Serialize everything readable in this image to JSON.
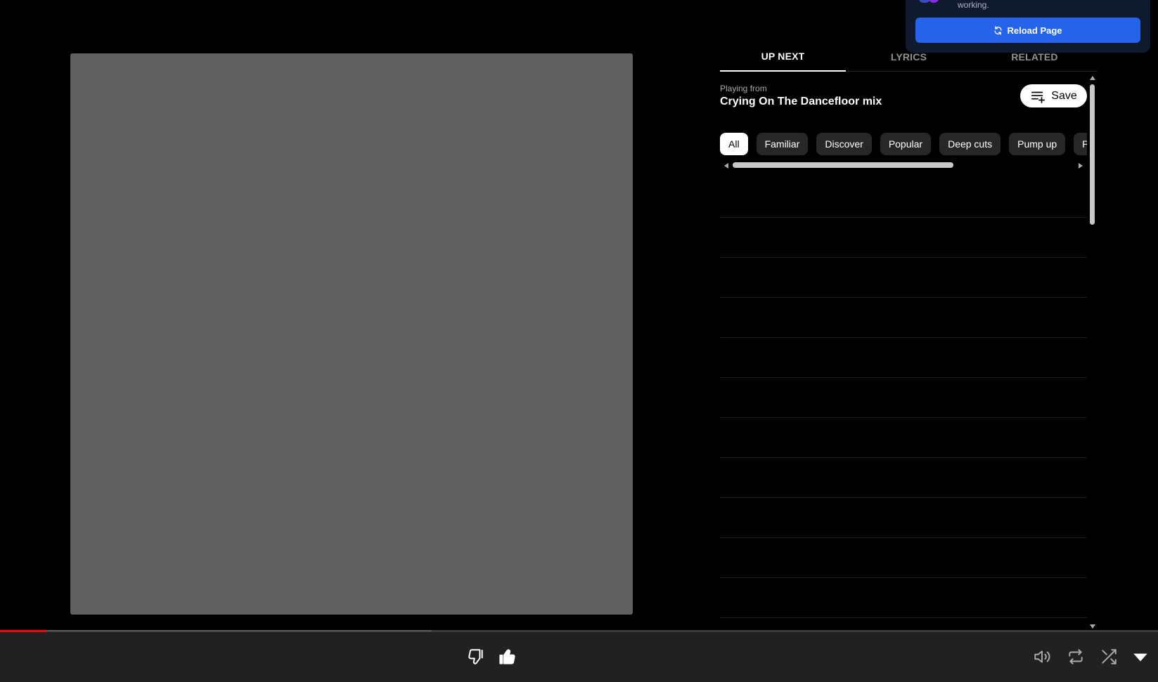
{
  "notification": {
    "message": "working.",
    "reload_label": "Reload Page"
  },
  "tabs": [
    {
      "label": "UP NEXT",
      "active": true
    },
    {
      "label": "LYRICS",
      "active": false
    },
    {
      "label": "RELATED",
      "active": false
    }
  ],
  "playing_from": {
    "label": "Playing from",
    "title": "Crying On The Dancefloor mix"
  },
  "save_button": {
    "label": "Save"
  },
  "chips": [
    {
      "label": "All",
      "active": true
    },
    {
      "label": "Familiar",
      "active": false
    },
    {
      "label": "Discover",
      "active": false
    },
    {
      "label": "Popular",
      "active": false
    },
    {
      "label": "Deep cuts",
      "active": false
    },
    {
      "label": "Pump up",
      "active": false
    },
    {
      "label": "Party",
      "active": false
    }
  ],
  "queue_row_count": 11,
  "progress": {
    "played_fraction": 0.04,
    "buffered_fraction": 0.373
  },
  "colors": {
    "accent_red": "#ff0000",
    "reload_blue": "#2563eb",
    "artwork_gray": "#606060"
  },
  "player_icons": [
    "thumbs-down-icon",
    "thumbs-up-icon",
    "volume-icon",
    "repeat-icon",
    "shuffle-icon",
    "expand-down-icon"
  ]
}
